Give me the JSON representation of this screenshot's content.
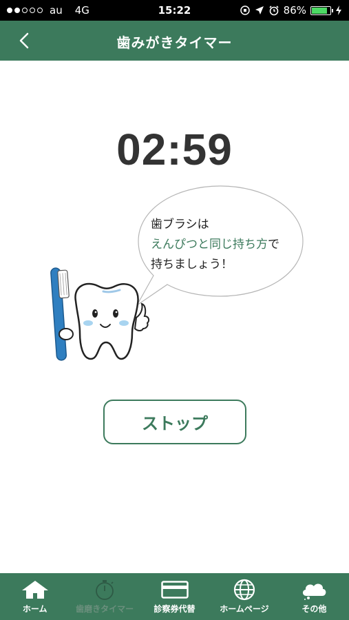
{
  "status_bar": {
    "carrier": "au",
    "network": "4G",
    "time": "15:22",
    "battery": "86%",
    "battery_level": 0.86
  },
  "nav": {
    "title": "歯みがきタイマー",
    "back_icon": "chevron-left-icon"
  },
  "timer": {
    "value": "02:59"
  },
  "bubble": {
    "line1": "歯ブラシは",
    "line2_highlight": "えんぴつと同じ持ち方",
    "line2_rest": "で",
    "line3": "持ちましょう！"
  },
  "stop_button": {
    "label": "ストップ"
  },
  "tabs": [
    {
      "label": "ホーム",
      "icon": "home-icon",
      "active": false
    },
    {
      "label": "歯磨きタイマー",
      "icon": "stopwatch-icon",
      "active": true
    },
    {
      "label": "診察券代替",
      "icon": "card-icon",
      "active": false
    },
    {
      "label": "ホームページ",
      "icon": "globe-icon",
      "active": false
    },
    {
      "label": "その他",
      "icon": "cloud-icon",
      "active": false
    }
  ],
  "colors": {
    "brand_green": "#3c7a5c",
    "tooth_blue": "#2f7fc0"
  }
}
